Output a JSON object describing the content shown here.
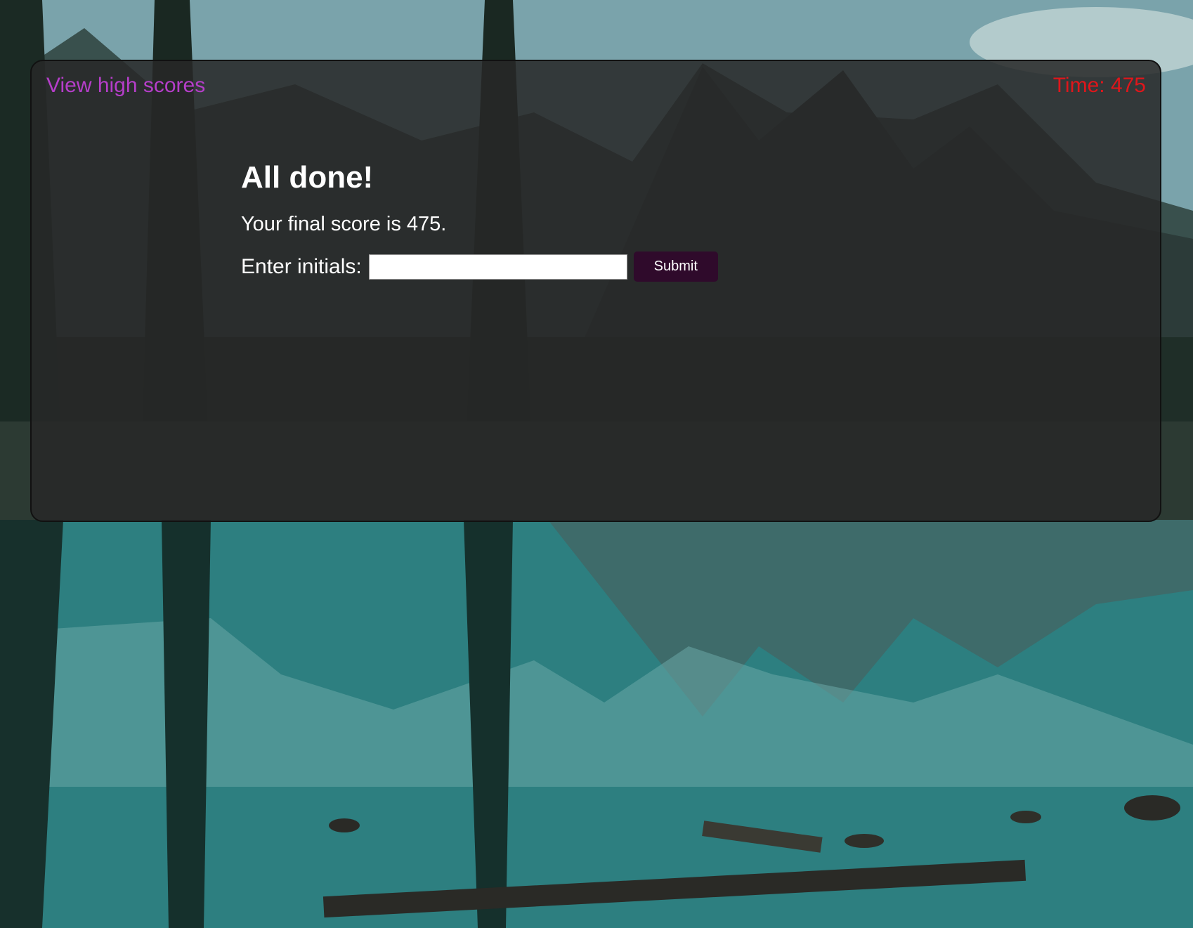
{
  "header": {
    "high_scores_link": "View high scores",
    "timer_label": "Time: ",
    "timer_value": "475"
  },
  "main": {
    "title": "All done!",
    "score_text": "Your final score is 475.",
    "initials_label": "Enter initials:",
    "initials_value": "",
    "submit_label": "Submit"
  },
  "colors": {
    "link": "#b53ec9",
    "timer": "#e0161b",
    "submit_bg": "#2f0a2b",
    "panel_bg": "rgba(40,40,40,0.86)"
  }
}
